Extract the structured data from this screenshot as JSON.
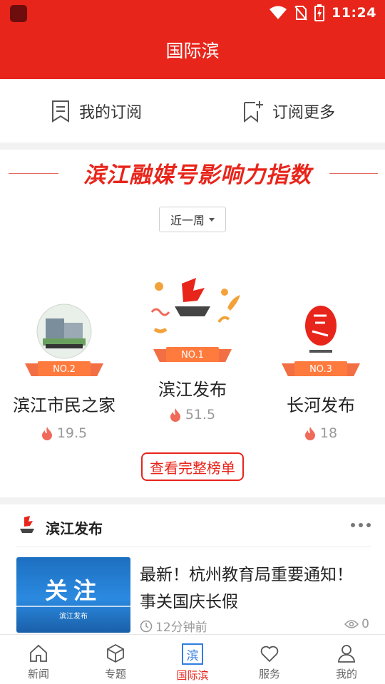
{
  "status_bar": {
    "time": "11:24"
  },
  "header": {
    "title": "国际滨"
  },
  "subscribe": {
    "my_label": "我的订阅",
    "more_label": "订阅更多"
  },
  "influence": {
    "banner_title": "滨江融媒号影响力指数",
    "period": "近一周",
    "ranks": [
      {
        "badge": "NO.1",
        "name": "滨江发布",
        "score": "51.5"
      },
      {
        "badge": "NO.2",
        "name": "滨江市民之家",
        "score": "19.5"
      },
      {
        "badge": "NO.3",
        "name": "长河发布",
        "score": "18"
      }
    ],
    "full_list_label": "查看完整榜单"
  },
  "feed": {
    "source": "滨江发布",
    "item": {
      "thumb_text": "关注",
      "thumb_sub": "滨江发布",
      "title": "最新！杭州教育局重要通知！事关国庆长假",
      "time": "12分钟前",
      "views": "0"
    }
  },
  "bottom_nav": [
    {
      "label": "新闻",
      "icon": "home-icon"
    },
    {
      "label": "专题",
      "icon": "cube-icon"
    },
    {
      "label": "国际滨",
      "icon": "bin-icon",
      "active": true
    },
    {
      "label": "服务",
      "icon": "heart-icon"
    },
    {
      "label": "我的",
      "icon": "person-icon"
    }
  ],
  "colors": {
    "brand_red": "#e8251b",
    "badge_orange": "#f26f43",
    "active_blue": "#2f7de0"
  }
}
